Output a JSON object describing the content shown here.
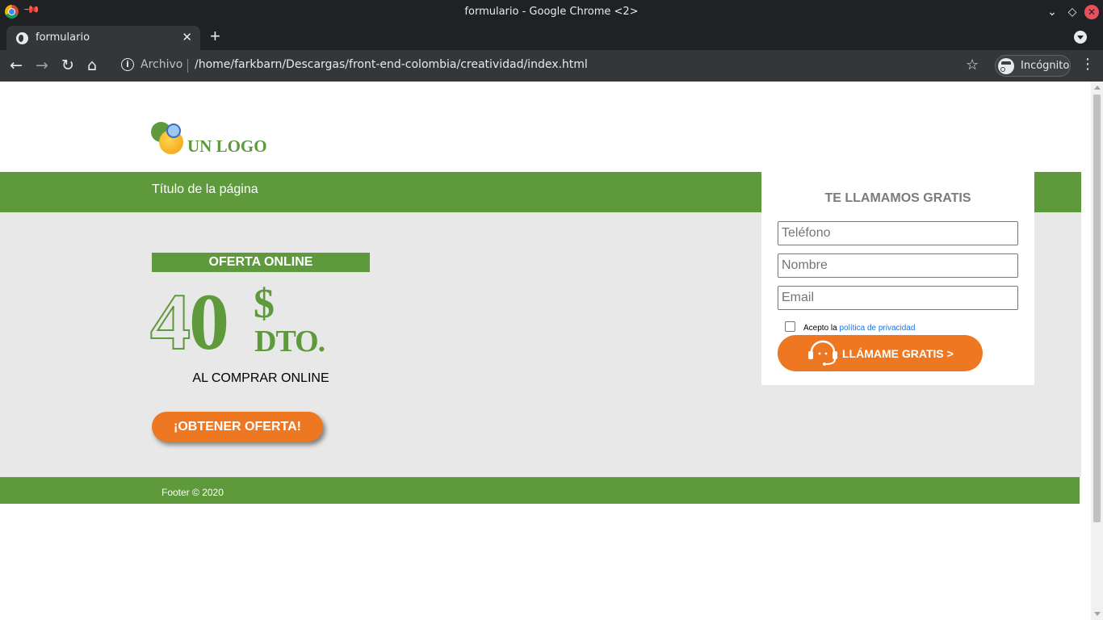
{
  "window": {
    "title": "formulario - Google Chrome <2>"
  },
  "tab": {
    "label": "formulario",
    "close": "✕",
    "new_tab": "+"
  },
  "toolbar": {
    "back": "←",
    "forward": "→",
    "reload": "↻",
    "home": "⌂",
    "info": "i",
    "scheme_label": "Archivo",
    "url": "/home/farkbarn/Descargas/front-end-colombia/creatividad/index.html",
    "star": "☆",
    "incognito_label": "Incógnito",
    "menu": "⋮"
  },
  "page": {
    "logo_text": "UN LOGO",
    "title": "Título de la página",
    "offer_tag": "OFERTA ONLINE",
    "big_four": "4",
    "big_zero": "0",
    "currency": "$",
    "discount_label": "DTO.",
    "buy_online": "AL COMPRAR ONLINE",
    "obtain_button": "¡OBTENER OFERTA!",
    "footer": "Footer © 2020"
  },
  "form": {
    "title": "TE LLAMAMOS GRATIS",
    "phone_placeholder": "Teléfono",
    "name_placeholder": "Nombre",
    "email_placeholder": "Email",
    "privacy_prefix": "Acepto la",
    "privacy_link": "política de privacidad",
    "privacy_checked": false,
    "call_button": "LLÁMAME GRATIS >"
  },
  "colors": {
    "brand_green": "#5e9a3c",
    "brand_orange": "#ee7821",
    "page_grey": "#e8e8e8",
    "chrome_dark": "#202124"
  },
  "icons": {
    "window": [
      "chrome-icon",
      "pin-icon",
      "minimize-icon",
      "maximize-icon",
      "close-icon"
    ],
    "tab": [
      "globe-icon",
      "tab-search-icon"
    ],
    "form": [
      "headset-icon"
    ]
  }
}
